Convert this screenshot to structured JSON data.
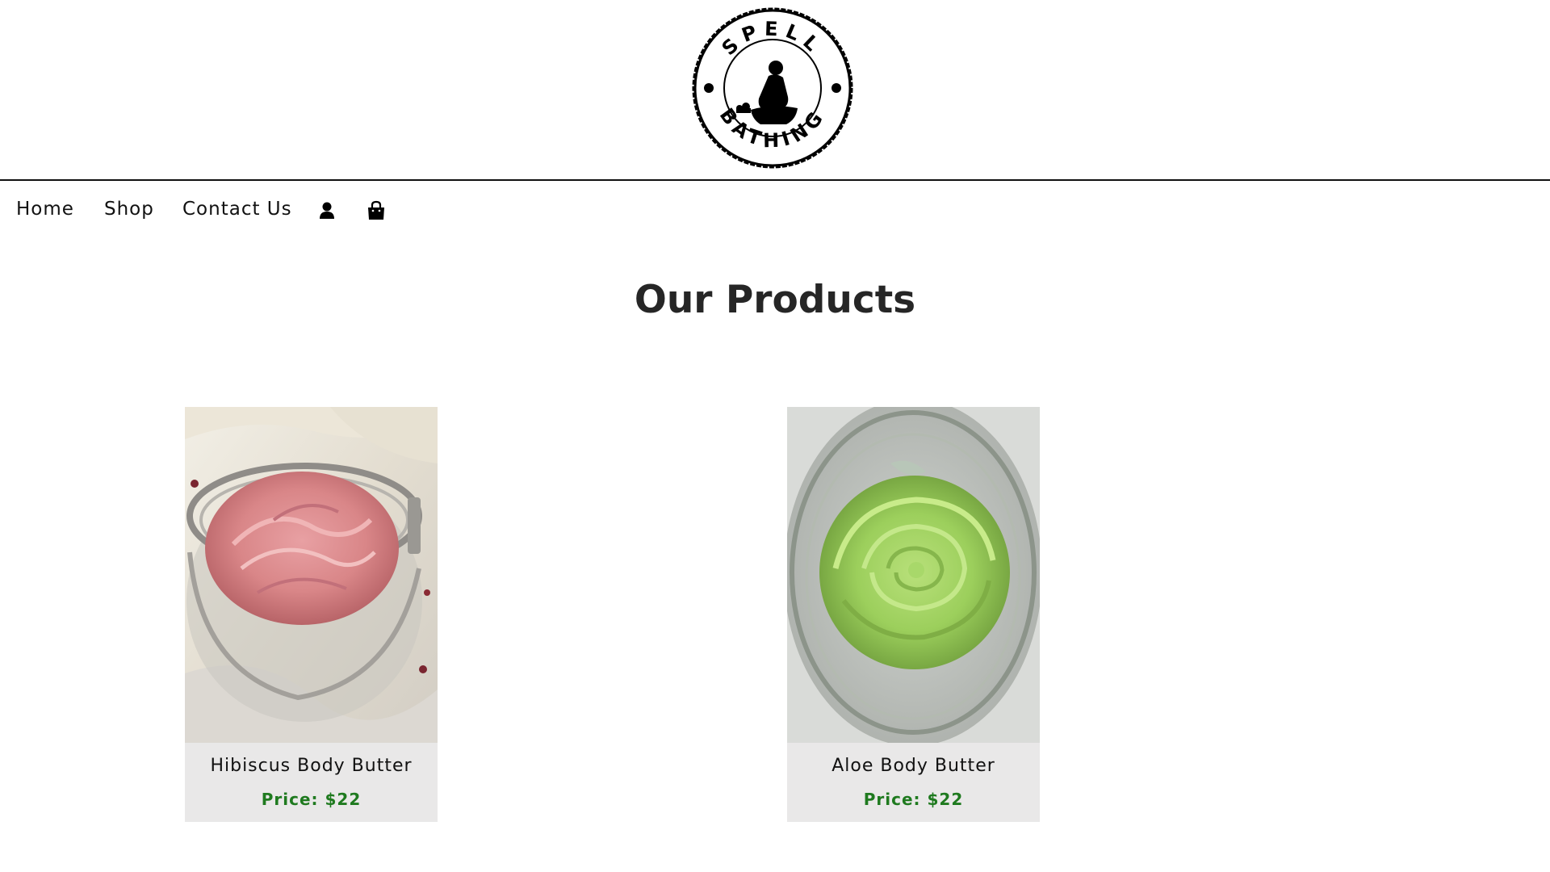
{
  "brand": {
    "logo_top_text": "SPELL",
    "logo_bottom_text": "BATHING"
  },
  "nav": {
    "items": [
      {
        "label": "Home"
      },
      {
        "label": "Shop"
      },
      {
        "label": "Contact Us"
      }
    ],
    "account_icon": "user-icon",
    "cart_icon": "shopping-bag-icon"
  },
  "main": {
    "title": "Our Products",
    "products": [
      {
        "name": "Hibiscus Body Butter",
        "price_label": "Price:",
        "price_value": "$22",
        "image_subject": "pink whipped body butter in glass jar"
      },
      {
        "name": "Aloe Body Butter",
        "price_label": "Price:",
        "price_value": "$22",
        "image_subject": "green whipped body butter in glass jar"
      }
    ]
  },
  "colors": {
    "price": "#1f7a1f",
    "card_background": "#e9e8e8",
    "text": "#111111"
  }
}
